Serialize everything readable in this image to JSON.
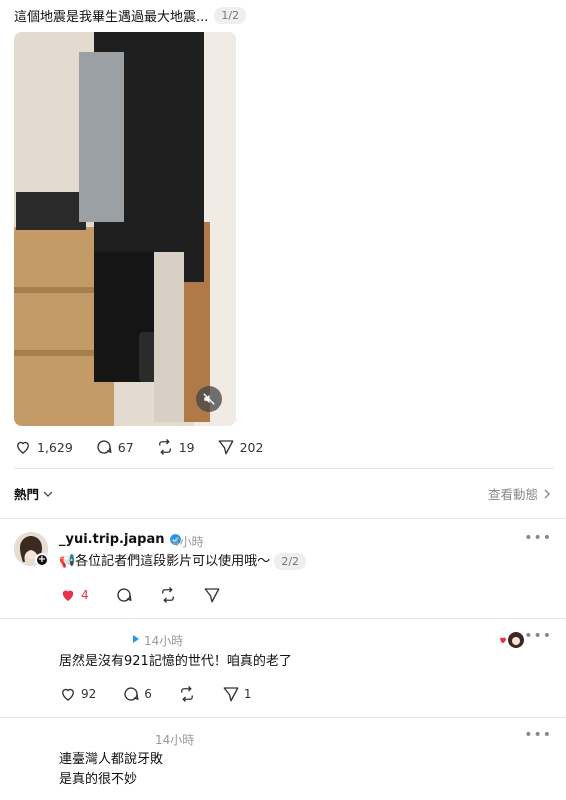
{
  "post": {
    "text": "這個地震是我畢生遇過最大地震...",
    "page_indicator": "1/2",
    "stats": {
      "likes": "1,629",
      "comments": "67",
      "reposts": "19",
      "shares": "202"
    }
  },
  "sort": {
    "label": "熱門",
    "view_activity": "查看動態"
  },
  "replies": [
    {
      "username": "_yui.trip.japan",
      "verified": true,
      "time": "4小時",
      "text": "📢各位記者們這段影片可以使用哦～",
      "page_indicator": "2/2",
      "likes": "4",
      "liked": true
    },
    {
      "time": "14小時",
      "text": "居然是沒有921記憶的世代！咱真的老了",
      "likes": "92",
      "comments": "6",
      "shares": "1"
    },
    {
      "time": "14小時",
      "text_line1": "連臺灣人都說牙敗",
      "text_line2": "是真的很不妙"
    }
  ],
  "colors": {
    "like_red": "#e8334d",
    "verified_blue": "#1d9bf0"
  }
}
